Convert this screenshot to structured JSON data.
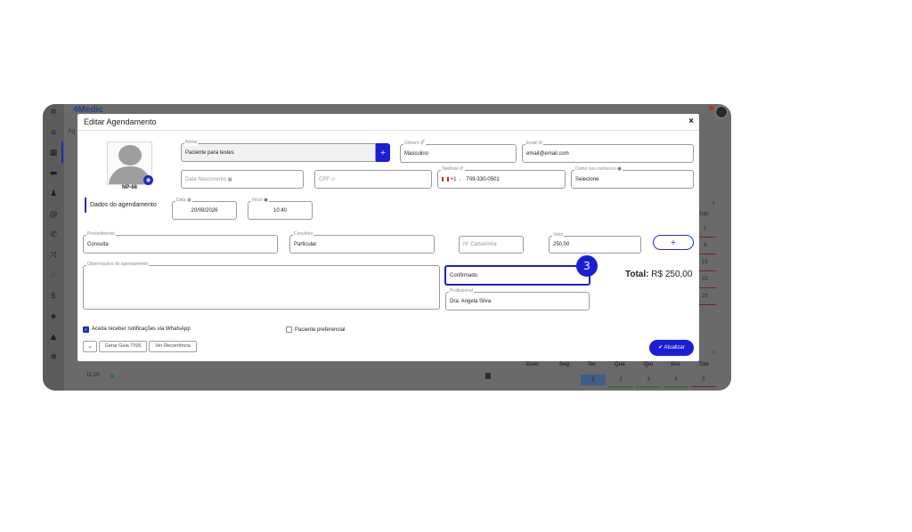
{
  "background_app": {
    "brand": "4Medic",
    "breadcrumb": "Ag",
    "calendar_top": {
      "last_col_header": "Sáb",
      "days": [
        "1",
        "8",
        "15",
        "22",
        "29"
      ]
    },
    "calendar_bottom": {
      "weekdays": [
        "Dom",
        "Seg",
        "Ter",
        "Qua",
        "Qui",
        "Sex",
        "Sáb"
      ],
      "days": [
        "1",
        "2",
        "3",
        "4",
        "5"
      ]
    },
    "time_slot": "11:20"
  },
  "modal": {
    "title": "Editar Agendamento",
    "close_symbol": "×",
    "patient_code": "NP-68",
    "fields": {
      "nome": {
        "label": "Nome",
        "value": "Paciente para testes"
      },
      "genero": {
        "label": "Gênero",
        "value": "Masculino"
      },
      "email": {
        "label": "Email",
        "value": "email@email.com"
      },
      "data_nascimento": {
        "placeholder": "Data Nascimento"
      },
      "cpf": {
        "placeholder": "CPF"
      },
      "telefone": {
        "label": "Telefone",
        "country_code": "+1",
        "value": "709-330-0501"
      },
      "como_conheceu": {
        "label": "Como nos conheceu",
        "value": "Selecione"
      },
      "data": {
        "label": "Data",
        "value": "20/08/2026"
      },
      "inicio": {
        "label": "Início",
        "value": "10:40"
      },
      "procedimento": {
        "label": "Procedimento",
        "value": "Consulta"
      },
      "convenio": {
        "label": "Convênio",
        "value": "Particular"
      },
      "carteirinha": {
        "placeholder": "Nº Carteirinha"
      },
      "valor": {
        "label": "Valor",
        "value": "250,00"
      },
      "observacoes": {
        "label": "Observações do agendamento"
      },
      "status": {
        "value": "Confirmado"
      },
      "profissional": {
        "label": "Profissional",
        "value": "Dra. Angela Silva"
      }
    },
    "section_label": "Dados do agendamento",
    "step_number": "3",
    "total_label": "Total:",
    "total_value": "R$ 250,00",
    "whatsapp_label": "Aceita receber notificações via WhatsApp",
    "whatsapp_checked": true,
    "preferencial_label": "Paciente preferencial",
    "preferencial_checked": false,
    "buttons": {
      "add_plus": "+",
      "nome_plus": "+",
      "gerar_guia": "Gerar Guia TISS",
      "ver_recorrencia": "Ver Recorrência",
      "atualizar": "✔ Atualizar"
    },
    "colors": {
      "accent": "#1a1fd6",
      "overlay": "#6a6a6a"
    }
  }
}
